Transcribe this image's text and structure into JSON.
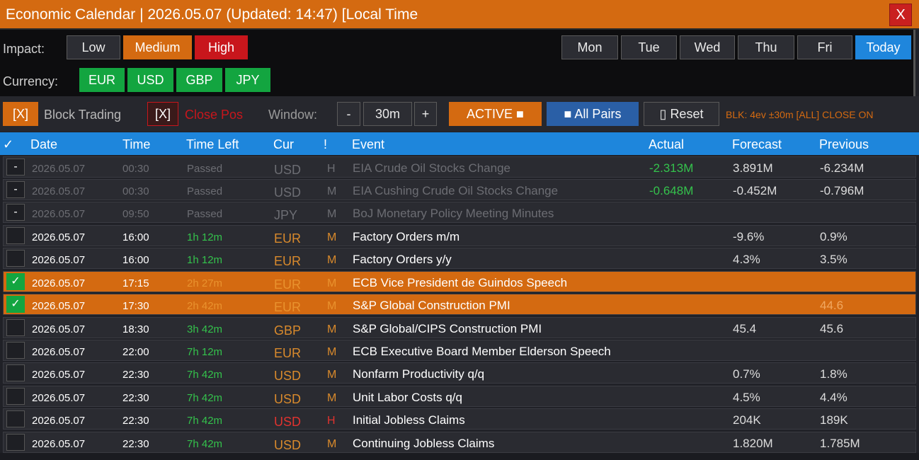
{
  "title": "Economic Calendar  |  2026.05.07  (Updated: 14:47)  [Local Time",
  "close_label": "X",
  "impact": {
    "label": "Impact:",
    "low": "Low",
    "medium": "Medium",
    "high": "High"
  },
  "currency": {
    "label": "Currency:",
    "items": [
      "EUR",
      "USD",
      "GBP",
      "JPY"
    ]
  },
  "days": [
    "Mon",
    "Tue",
    "Wed",
    "Thu",
    "Fri",
    "Today"
  ],
  "toolbar": {
    "block_check": "[X]",
    "block_label": "Block Trading",
    "close_check": "[X]",
    "close_label": "Close Pos",
    "window_label": "Window:",
    "minus": "-",
    "window_value": "30m",
    "plus": "+",
    "active": "ACTIVE ■",
    "all_pairs": "■ All Pairs",
    "reset": "▯ Reset",
    "status": "BLK: 4ev ±30m [ALL]   CLOSE ON"
  },
  "columns": [
    "✓",
    "Date",
    "Time",
    "Time Left",
    "Cur",
    "!",
    "Event",
    "Actual",
    "Forecast",
    "Previous"
  ],
  "rows": [
    {
      "check": "-",
      "date": "2026.05.07",
      "time": "00:30",
      "left": "Passed",
      "cur": "USD",
      "imp": "H",
      "event": "EIA Crude Oil Stocks Change",
      "actual": "-2.313M",
      "forecast": "3.891M",
      "previous": "-6.234M"
    },
    {
      "check": "-",
      "date": "2026.05.07",
      "time": "00:30",
      "left": "Passed",
      "cur": "USD",
      "imp": "M",
      "event": "EIA Cushing Crude Oil Stocks Change",
      "actual": "-0.648M",
      "forecast": "-0.452M",
      "previous": "-0.796M"
    },
    {
      "check": "-",
      "date": "2026.05.07",
      "time": "09:50",
      "left": "Passed",
      "cur": "JPY",
      "imp": "M",
      "event": "BoJ Monetary Policy Meeting Minutes",
      "actual": "",
      "forecast": "",
      "previous": ""
    },
    {
      "check": "",
      "date": "2026.05.07",
      "time": "16:00",
      "left": "1h 12m",
      "cur": "EUR",
      "imp": "M",
      "event": "Factory Orders m/m",
      "actual": "",
      "forecast": "-9.6%",
      "previous": "0.9%"
    },
    {
      "check": "",
      "date": "2026.05.07",
      "time": "16:00",
      "left": "1h 12m",
      "cur": "EUR",
      "imp": "M",
      "event": "Factory Orders y/y",
      "actual": "",
      "forecast": "4.3%",
      "previous": "3.5%"
    },
    {
      "check": "✓",
      "date": "2026.05.07",
      "time": "17:15",
      "left": "2h 27m",
      "cur": "EUR",
      "imp": "M",
      "event": "ECB Vice President de Guindos Speech",
      "actual": "",
      "forecast": "",
      "previous": ""
    },
    {
      "check": "✓",
      "date": "2026.05.07",
      "time": "17:30",
      "left": "2h 42m",
      "cur": "EUR",
      "imp": "M",
      "event": "S&P Global Construction PMI",
      "actual": "",
      "forecast": "",
      "previous": "44.6"
    },
    {
      "check": "",
      "date": "2026.05.07",
      "time": "18:30",
      "left": "3h 42m",
      "cur": "GBP",
      "imp": "M",
      "event": "S&P Global/CIPS Construction PMI",
      "actual": "",
      "forecast": "45.4",
      "previous": "45.6"
    },
    {
      "check": "",
      "date": "2026.05.07",
      "time": "22:00",
      "left": "7h 12m",
      "cur": "EUR",
      "imp": "M",
      "event": "ECB Executive Board Member Elderson Speech",
      "actual": "",
      "forecast": "",
      "previous": ""
    },
    {
      "check": "",
      "date": "2026.05.07",
      "time": "22:30",
      "left": "7h 42m",
      "cur": "USD",
      "imp": "M",
      "event": "Nonfarm Productivity q/q",
      "actual": "",
      "forecast": "0.7%",
      "previous": "1.8%"
    },
    {
      "check": "",
      "date": "2026.05.07",
      "time": "22:30",
      "left": "7h 42m",
      "cur": "USD",
      "imp": "M",
      "event": "Unit Labor Costs q/q",
      "actual": "",
      "forecast": "4.5%",
      "previous": "4.4%"
    },
    {
      "check": "",
      "date": "2026.05.07",
      "time": "22:30",
      "left": "7h 42m",
      "cur": "USD",
      "imp": "H",
      "event": "Initial Jobless Claims",
      "actual": "",
      "forecast": "204K",
      "previous": "189K"
    },
    {
      "check": "",
      "date": "2026.05.07",
      "time": "22:30",
      "left": "7h 42m",
      "cur": "USD",
      "imp": "M",
      "event": "Continuing Jobless Claims",
      "actual": "",
      "forecast": "1.820M",
      "previous": "1.785M"
    }
  ]
}
